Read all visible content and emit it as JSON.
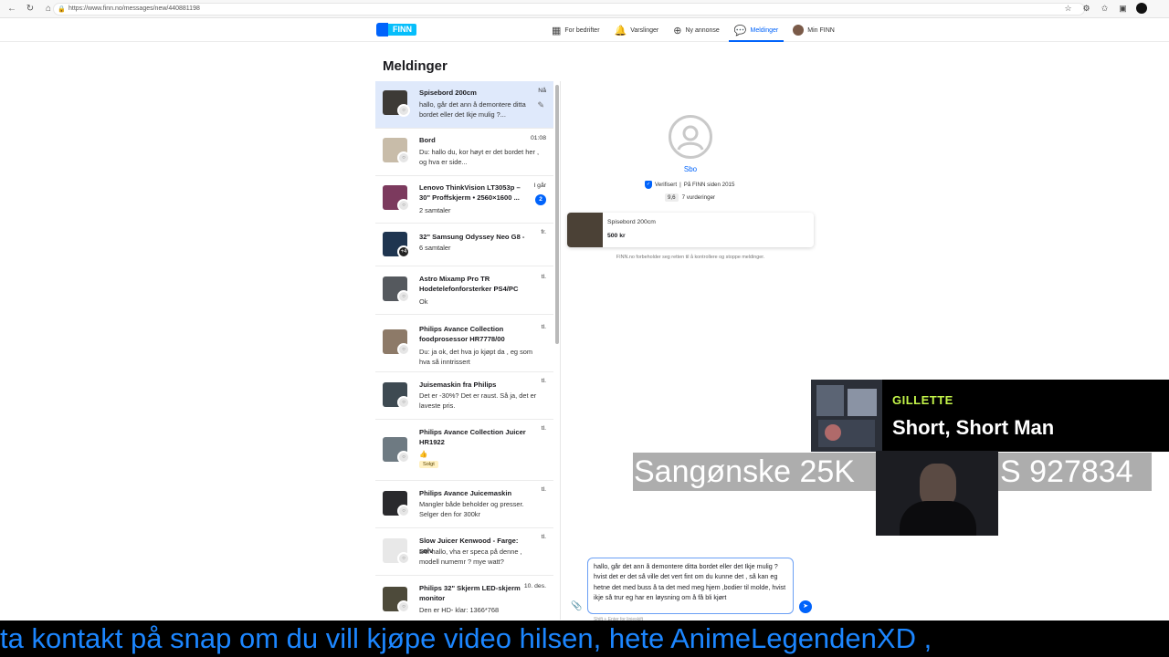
{
  "browser": {
    "url": "https://www.finn.no/messages/new/440881198"
  },
  "header": {
    "logo_text": "FINN",
    "nav": [
      {
        "label": "For bedrifter"
      },
      {
        "label": "Varslinger"
      },
      {
        "label": "Ny annonse"
      },
      {
        "label": "Meldinger"
      },
      {
        "label": "Min FINN"
      }
    ]
  },
  "page": {
    "title": "Meldinger"
  },
  "conversations": [
    {
      "title": "Spisebord 200cm",
      "snippet": "hallo, går det ann å demontere ditta bordet eller det Ikje mulig ?...",
      "time": "Nå"
    },
    {
      "title": "Bord",
      "snippet": "Du: hallo du, kor høyt er det bordet her , og hva er side...",
      "time": "01:08"
    },
    {
      "title": "Lenovo ThinkVision LT3053p – 30\" Proffskjerm • 2560×1600 ...",
      "snippet": "2 samtaler",
      "time": "I går",
      "unread": "2"
    },
    {
      "title": "32\" Samsung Odyssey Neo G8 -",
      "snippet": "6 samtaler",
      "time": "fr.",
      "badge": "+4"
    },
    {
      "title": "Astro Mixamp Pro TR Hodetelefonforsterker PS4/PC",
      "snippet": "Ok",
      "time": "tl."
    },
    {
      "title": "Philips Avance Collection foodprosessor HR7778/00",
      "snippet": "Du: ja ok, det hva jo kjøpt da , eg som hva så inntrissert",
      "time": "tl."
    },
    {
      "title": "Juisemaskin fra Philips",
      "snippet": "Det er -30%? Det er raust. Så ja, det er laveste pris.",
      "time": "tl."
    },
    {
      "title": "Philips Avance Collection Juicer HR1922",
      "snippet": "👍",
      "time": "tl.",
      "status": "Solgt"
    },
    {
      "title": "Philips Avance Juicemaskin",
      "snippet": "Mangler både beholder og presser. Selger den for 300kr",
      "time": "tl."
    },
    {
      "title": "Slow Juicer Kenwood - Farge: sølv",
      "snippet": "Du: hallo, vha er speca på denne , modell numemr ? mye watt?",
      "time": "tl."
    },
    {
      "title": "Philips 32\" Skjerm LED-skjerm monitor",
      "snippet": "Den er HD- klar: 1366*768",
      "time": "10. des."
    }
  ],
  "seller": {
    "name": "Sbo",
    "verified_text": "Verifisert",
    "member_text": "På FINN siden 2015",
    "score": "9,6",
    "reviews": "7 vurderinger"
  },
  "ad": {
    "title": "Spisebord 200cm",
    "price": "500 kr"
  },
  "disclaimer": "FINN.no forbeholder seg retten til å kontrollere og stoppe meldinger.",
  "composer": {
    "text": "hallo, går det ann å  demontere  ditta bordet eller det Ikje mulig ? hvist det er det så ville det vert fint om du kunne det , så kan eg hetne det med buss å ta det med meg hjem ,bodier til molde, hvist ikje så trur eg har en løysning om å få  bli kjørt",
    "hint": "Shift + Enter for linjeskift"
  },
  "overlay": {
    "artist": "GILLETTE",
    "track": "Short, Short Man",
    "request": "Sangønske 25K",
    "request_tail": "S 927834",
    "ticker": "ta kontakt  på snap om du vill kjøpe video  hilsen, hete AnimeLegendenXD ,"
  },
  "colors": {
    "finn_blue": "#0063fb",
    "finn_cyan": "#06befb",
    "selected_bg": "#dfe9fb",
    "overlay_green": "#c4f54a",
    "ticker_blue": "#1c86ff"
  }
}
